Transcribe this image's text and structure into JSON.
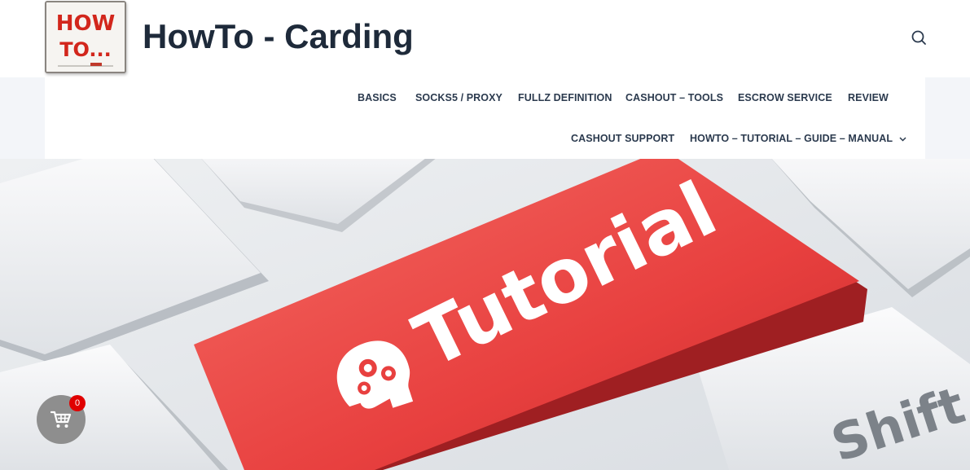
{
  "header": {
    "site_title": "HowTo - Carding",
    "logo_text_line1": "HOW",
    "logo_text_line2": "TO..."
  },
  "nav": {
    "row1": [
      "BASICS",
      "SOCKS5 / PROXY",
      "FULLZ DEFINITION",
      "CASHOUT – TOOLS",
      "ESCROW SERVICE",
      "REVIEW"
    ],
    "row2": [
      "CASHOUT SUPPORT",
      "HOWTO – TUTORIAL – GUIDE – MANUAL"
    ]
  },
  "hero": {
    "key_text": "Tutorial",
    "shift_text": "Shift"
  },
  "cart": {
    "count": "0"
  },
  "icons": {
    "search": "search-icon",
    "cart": "cart-icon",
    "chevron": "chevron-down-icon",
    "brain_gears": "brain-gears-icon"
  },
  "colors": {
    "title": "#1e2a3a",
    "nav_text": "#2b3a4e",
    "nav_band": "#f3f5f9",
    "key_red": "#e8403f",
    "badge_red": "#e00000",
    "cart_gray": "#8e8e8e"
  }
}
